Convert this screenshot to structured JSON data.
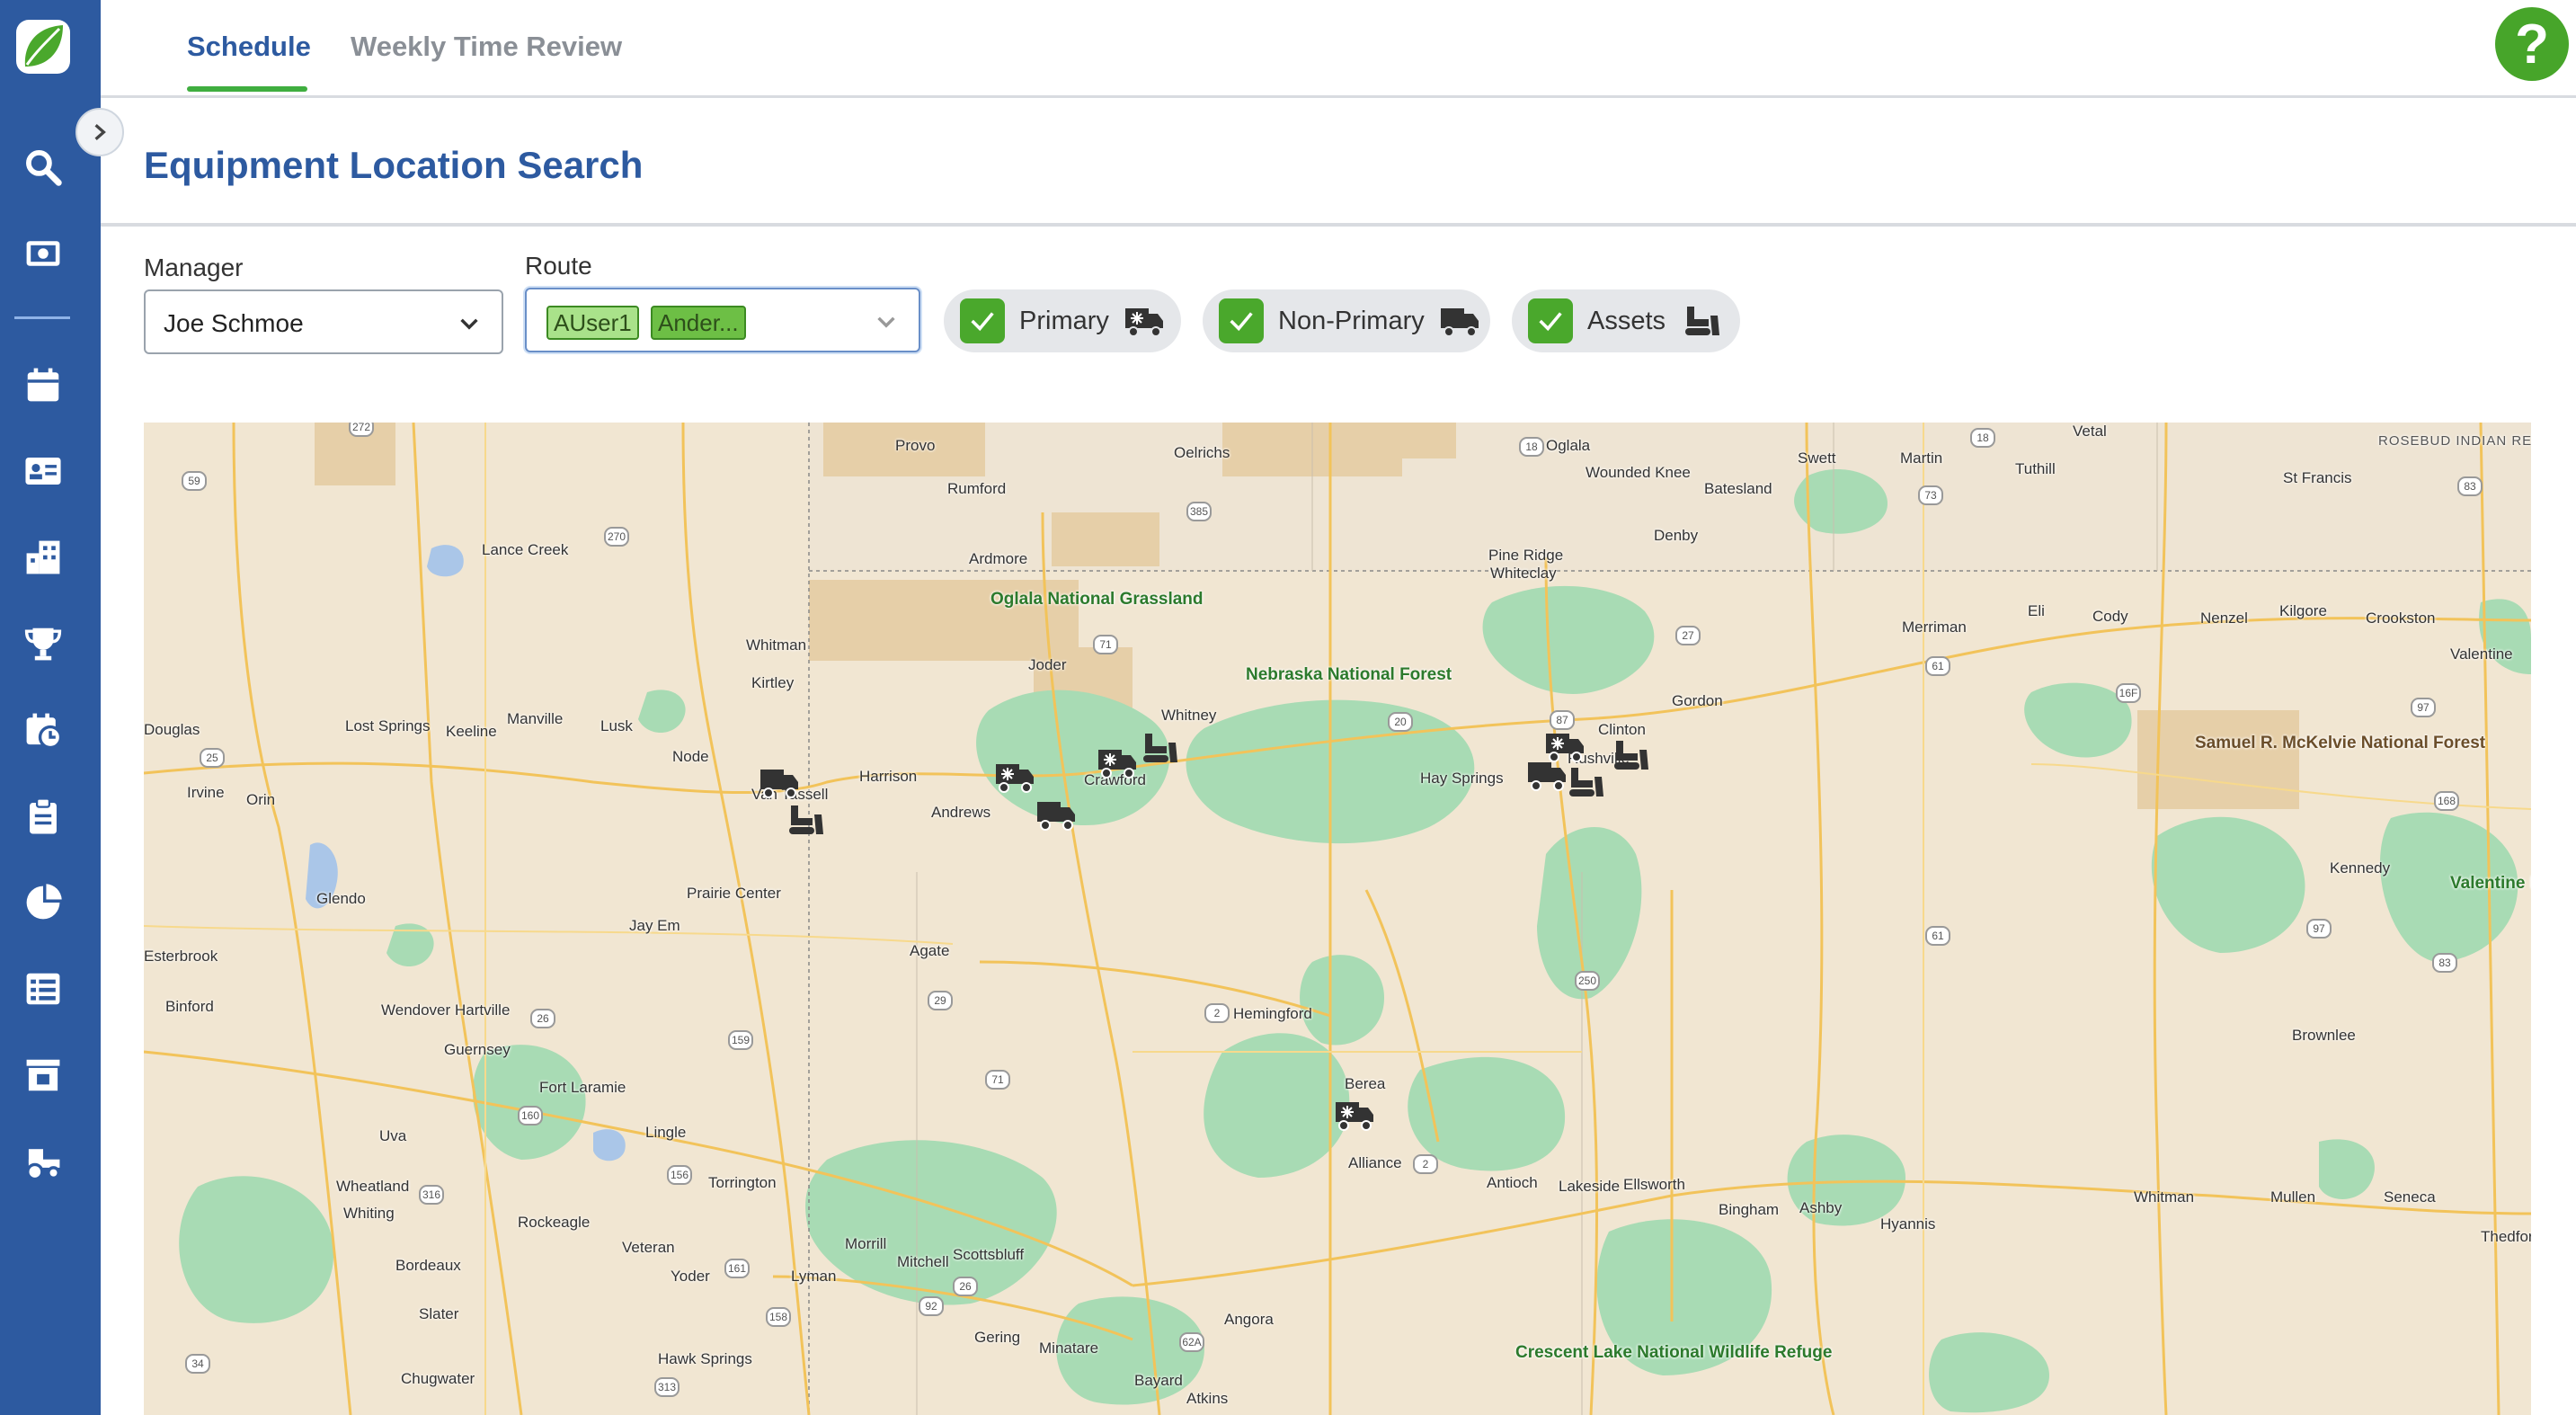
{
  "app": {
    "logo_icon": "leaf-logo-icon",
    "accent": "#2d5aa0",
    "brand_green": "#47a52a"
  },
  "tabs": [
    {
      "label": "Schedule",
      "active": true
    },
    {
      "label": "Weekly Time Review",
      "active": false
    }
  ],
  "help": {
    "label": "?"
  },
  "sidebar": {
    "items": [
      {
        "icon": "search-icon"
      },
      {
        "icon": "money-icon"
      },
      {
        "icon": "calendar-icon"
      },
      {
        "icon": "contact-card-icon"
      },
      {
        "icon": "building-icon"
      },
      {
        "icon": "trophy-icon"
      },
      {
        "icon": "calendar-clock-icon"
      },
      {
        "icon": "clipboard-icon"
      },
      {
        "icon": "pie-chart-icon"
      },
      {
        "icon": "list-icon"
      },
      {
        "icon": "store-icon"
      },
      {
        "icon": "tractor-icon"
      }
    ]
  },
  "page": {
    "title": "Equipment Location Search"
  },
  "filters": {
    "manager_label": "Manager",
    "manager_value": "Joe Schmoe",
    "route_label": "Route",
    "route_chips": [
      "AUser1",
      "Ander..."
    ],
    "toggles": [
      {
        "label": "Primary",
        "checked": true,
        "icon": "truck-snowflake-icon"
      },
      {
        "label": "Non-Primary",
        "checked": true,
        "icon": "truck-icon"
      },
      {
        "label": "Assets",
        "checked": true,
        "icon": "bulldozer-icon"
      }
    ]
  },
  "map": {
    "places": [
      "Provo",
      "Oelrichs",
      "Oglala",
      "Swett",
      "Martin",
      "Vetal",
      "Rumford",
      "Wounded Knee",
      "Batesland",
      "Tuthill",
      "St Francis",
      "Lance Creek",
      "Ardmore",
      "Pine Ridge",
      "Whiteclay",
      "Denby",
      "Merriman",
      "Eli",
      "Cody",
      "Nenzel",
      "Kilgore",
      "Crookston",
      "Valentine",
      "Whitman",
      "Kirtley",
      "Joder",
      "Whitney",
      "Clinton",
      "Gordon",
      "Douglas",
      "Lost Springs",
      "Keeline",
      "Manville",
      "Lusk",
      "Node",
      "Van Tassell",
      "Harrison",
      "Andrews",
      "Crawford",
      "Hay Springs",
      "Rushville",
      "Irvine",
      "Orin",
      "Glendo",
      "Prairie Center",
      "Jay Em",
      "Agate",
      "Kennedy",
      "Esterbrook",
      "Binford",
      "Wendover",
      "Hartville",
      "Hemingford",
      "Guernsey",
      "Fort Laramie",
      "Berea",
      "Uva",
      "Lingle",
      "Alliance",
      "Antioch",
      "Lakeside",
      "Ellsworth",
      "Bingham",
      "Ashby",
      "Hyannis",
      "Whitman",
      "Mullen",
      "Seneca",
      "Thedford",
      "Brownlee",
      "Wheatland",
      "Whiting",
      "Torrington",
      "Rockeagle",
      "Veteran",
      "Morrill",
      "Mitchell",
      "Bordeaux",
      "Yoder",
      "Lyman",
      "Scottsbluff",
      "Angora",
      "Slater",
      "Gering",
      "Minatare",
      "Chugwater",
      "Hawk Springs",
      "Bayard",
      "Atkins"
    ],
    "parks": [
      "Oglala National Grassland",
      "Nebraska National Forest",
      "Crescent Lake National Wildlife Refuge",
      "Valentine National Wildlife Refuge"
    ],
    "forests": [
      "Samuel R. McKelvie National Forest"
    ],
    "reservations": [
      "ROSEBUD INDIAN RESERVATION"
    ],
    "routes": [
      "272",
      "59",
      "18",
      "270",
      "385",
      "71",
      "20",
      "87",
      "27",
      "73",
      "83",
      "18",
      "61",
      "16F",
      "97",
      "168",
      "25",
      "26",
      "159",
      "29",
      "2",
      "250",
      "61",
      "97",
      "83",
      "156",
      "161",
      "92",
      "26",
      "62A",
      "313",
      "34",
      "158",
      "316",
      "160",
      "71",
      "2"
    ]
  }
}
